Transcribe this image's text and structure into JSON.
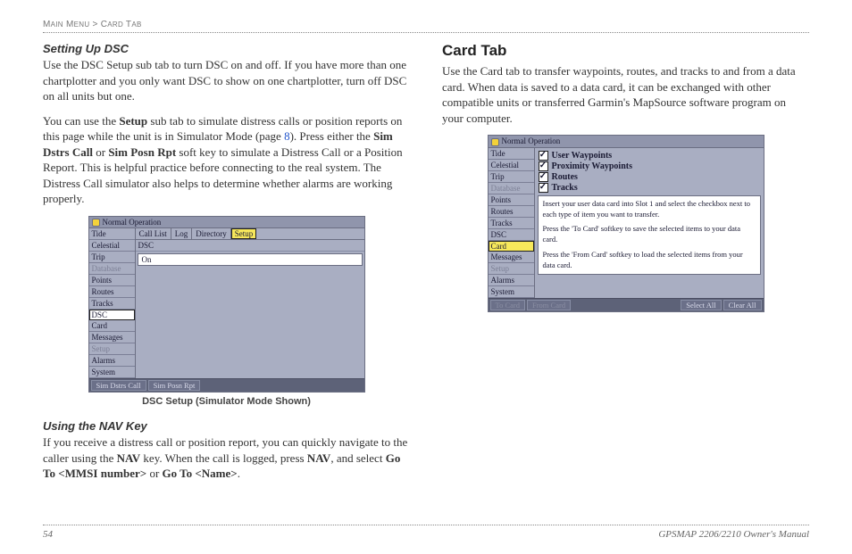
{
  "breadcrumb": "MAIN MENU > CARD TAB",
  "left": {
    "h_setup": "Setting Up DSC",
    "p1a": "Use the DSC Setup sub tab to turn DSC on and off. If you have more than one chartplotter and you only want DSC to show on one chartplotter, turn off DSC on all units but one.",
    "p2a": "You can use the ",
    "p2b": "Setup",
    "p2c": " sub tab to simulate distress calls or position reports on this page while the unit is in Simulator Mode (page ",
    "p2_link": "8",
    "p2d": "). Press either the ",
    "p2e": "Sim Dstrs Call",
    "p2f": " or ",
    "p2g": "Sim Posn Rpt",
    "p2h": " soft key to simulate a Distress Call or a Position Report. This is helpful practice before connecting to the real system. The Distress Call simulator also helps to determine whether alarms are working properly.",
    "caption": "DSC Setup (Simulator Mode Shown)",
    "h_nav": "Using the NAV Key",
    "p3a": "If you receive a distress call or position report, you can quickly navigate to the caller using the ",
    "p3b": "NAV",
    "p3c": " key. When the call is logged, press ",
    "p3d": "NAV",
    "p3e": ", and select ",
    "p3f": "Go To <MMSI number>",
    "p3g": " or ",
    "p3h": "Go To <Name>",
    "p3i": "."
  },
  "right": {
    "h_card": "Card Tab",
    "p1": "Use the Card tab to transfer waypoints, routes, and tracks to and from a data card. When data is saved to a data card, it can be exchanged with other compatible units or transferred Garmin's MapSource software program on your computer."
  },
  "device1": {
    "title": "Normal Operation",
    "side": [
      "Tide",
      "Celestial",
      "Trip",
      "Database",
      "Points",
      "Routes",
      "Tracks",
      "DSC",
      "Card",
      "Messages",
      "Setup",
      "Alarms",
      "System"
    ],
    "sel_index": 7,
    "tabs": [
      "Call List",
      "Log",
      "Directory",
      "Setup"
    ],
    "active_tab": 3,
    "subhdr": "DSC",
    "value": "On",
    "btns_left": [
      "Sim Dstrs Call",
      "Sim Posn Rpt"
    ]
  },
  "device2": {
    "title": "Normal Operation",
    "side": [
      "Tide",
      "Celestial",
      "Trip",
      "Database",
      "Points",
      "Routes",
      "Tracks",
      "DSC",
      "Card",
      "Messages",
      "Setup",
      "Alarms",
      "System"
    ],
    "sel_index": 8,
    "checks": [
      "User Waypoints",
      "Proximity Waypoints",
      "Routes",
      "Tracks"
    ],
    "instr1": "Insert your user data card into Slot 1 and select the checkbox next to each type of item you want to transfer.",
    "instr2": "Press the 'To Card' softkey to save the selected items to your data card.",
    "instr3": "Press the 'From Card' softkey to load the selected items from your data card.",
    "btns_left": [
      "To Card",
      "From Card"
    ],
    "btns_right": [
      "Select All",
      "Clear All"
    ]
  },
  "footer": {
    "page": "54",
    "manual": "GPSMAP 2206/2210 Owner's Manual"
  }
}
